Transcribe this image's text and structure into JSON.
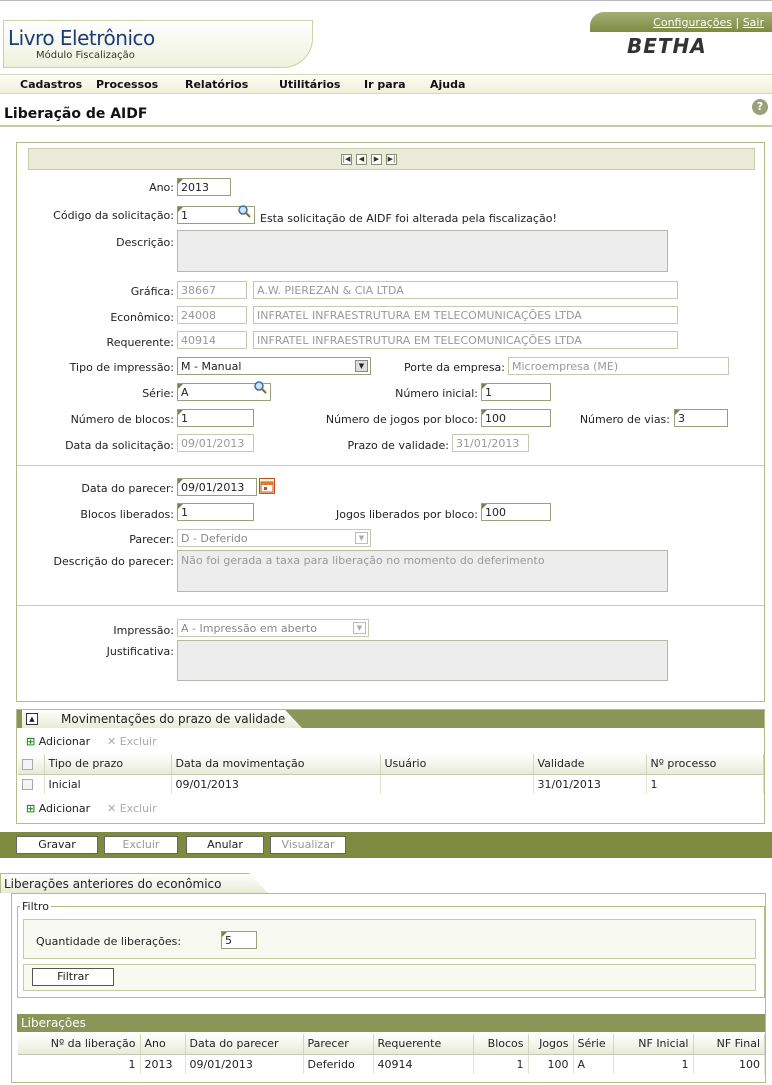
{
  "app": {
    "title": "Livro Eletrônico",
    "subtitle": "Módulo Fiscalização",
    "brand": "BETHA",
    "links": {
      "config": "Configurações",
      "sep": "|",
      "exit": "Sair"
    }
  },
  "menu": [
    "Cadastros",
    "Processos",
    "Relatórios",
    "Utilitários",
    "Ir para",
    "Ajuda"
  ],
  "page_title": "Liberação de AIDF",
  "help_icon": "?",
  "form": {
    "ano_label": "Ano:",
    "ano": "2013",
    "codigo_label": "Código da solicitação:",
    "codigo": "1",
    "codigo_msg": "Esta solicitação de AIDF foi alterada pela fiscalização!",
    "descricao_label": "Descrição:",
    "grafica_label": "Gráfica:",
    "grafica_cod": "38667",
    "grafica_nome": "A.W. PIEREZAN & CIA LTDA",
    "economico_label": "Econômico:",
    "economico_cod": "24008",
    "economico_nome": "INFRATEL INFRAESTRUTURA EM TELECOMUNICAÇÕES LTDA",
    "requerente_label": "Requerente:",
    "requerente_cod": "40914",
    "requerente_nome": "INFRATEL INFRAESTRUTURA EM TELECOMUNICAÇÕES LTDA",
    "tipo_label": "Tipo de impressão:",
    "tipo": "M - Manual",
    "porte_label": "Porte da empresa:",
    "porte": "Microempresa (ME)",
    "serie_label": "Série:",
    "serie": "A",
    "num_inicial_label": "Número inicial:",
    "num_inicial": "1",
    "num_blocos_label": "Número de blocos:",
    "num_blocos": "1",
    "jogos_label": "Número de jogos por bloco:",
    "jogos": "100",
    "vias_label": "Número de vias:",
    "vias": "3",
    "data_sol_label": "Data da solicitação:",
    "data_sol": "09/01/2013",
    "prazo_label": "Prazo de validade:",
    "prazo": "31/01/2013",
    "data_parecer_label": "Data do parecer:",
    "data_parecer": "09/01/2013",
    "blocos_lib_label": "Blocos liberados:",
    "blocos_lib": "1",
    "jogos_lib_label": "Jogos liberados por bloco:",
    "jogos_lib": "100",
    "parecer_label": "Parecer:",
    "parecer": "D - Deferido",
    "desc_parecer_label": "Descrição do parecer:",
    "desc_parecer": "Não foi gerada a taxa para liberação no momento do deferimento",
    "impressao_label": "Impressão:",
    "impressao": "A - Impressão em aberto",
    "justificativa_label": "Justificativa:"
  },
  "movimentacoes": {
    "title": "Movimentações do prazo de validade",
    "add": "Adicionar",
    "del": "Excluir",
    "columns": [
      "Tipo de prazo",
      "Data da movimentação",
      "Usuário",
      "Validade",
      "Nº processo"
    ],
    "rows": [
      [
        "Inicial",
        "09/01/2013",
        "",
        "31/01/2013",
        "1"
      ]
    ]
  },
  "actions": [
    "Gravar",
    "Excluir",
    "Anular",
    "Visualizar"
  ],
  "liberacoes_anteriores": {
    "tab": "Liberações anteriores do econômico",
    "filtro_legend": "Filtro",
    "qtd_label": "Quantidade de liberações:",
    "qtd": "5",
    "filtrar": "Filtrar",
    "grid_title": "Liberações",
    "columns": [
      "Nº da liberação",
      "Ano",
      "Data do parecer",
      "Parecer",
      "Requerente",
      "Blocos",
      "Jogos",
      "Série",
      "NF Inicial",
      "NF Final"
    ],
    "rows": [
      [
        "1",
        "2013",
        "09/01/2013",
        "Deferido",
        "40914",
        "1",
        "100",
        "A",
        "1",
        "100"
      ]
    ]
  }
}
